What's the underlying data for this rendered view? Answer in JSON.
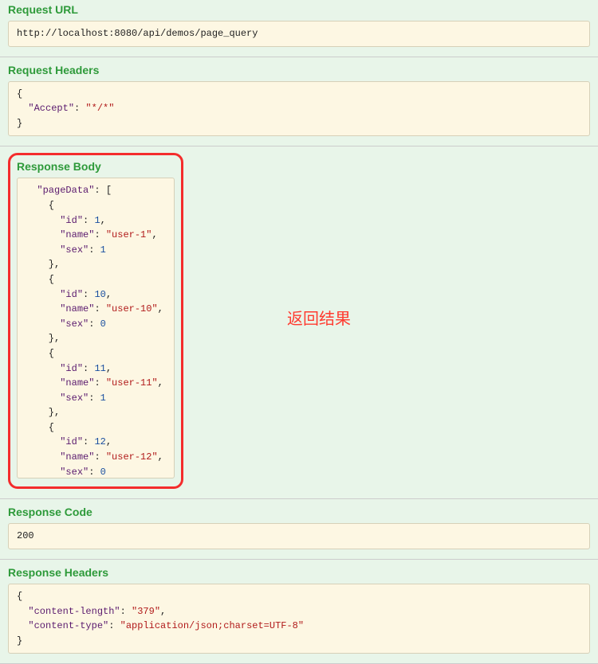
{
  "sections": {
    "requestUrl": {
      "title": "Request URL",
      "value": "http://localhost:8080/api/demos/page_query"
    },
    "requestHeaders": {
      "title": "Request Headers",
      "json": {
        "Accept": "*/*"
      }
    },
    "responseBody": {
      "title": "Response Body",
      "annotation": "返回结果",
      "data": {
        "pageData": [
          {
            "id": 1,
            "name": "user-1",
            "sex": 1
          },
          {
            "id": 10,
            "name": "user-10",
            "sex": 0
          },
          {
            "id": 11,
            "name": "user-11",
            "sex": 1
          },
          {
            "id": 12,
            "name": "user-12",
            "sex": 0
          }
        ]
      }
    },
    "responseCode": {
      "title": "Response Code",
      "value": "200"
    },
    "responseHeaders": {
      "title": "Response Headers",
      "json": {
        "content-length": "379",
        "content-type": "application/json;charset=UTF-8"
      }
    }
  }
}
